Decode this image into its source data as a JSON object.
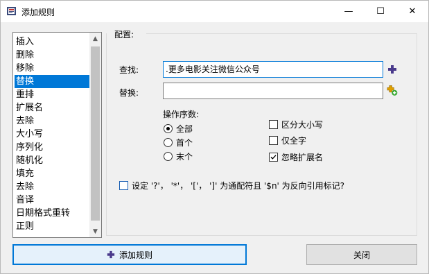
{
  "window": {
    "title": "添加规则",
    "minimize_glyph": "—",
    "maximize_glyph": "☐",
    "close_glyph": "✕"
  },
  "rules_list": {
    "items": [
      "插入",
      "删除",
      "移除",
      "替换",
      "重排",
      "扩展名",
      "去除",
      "大小写",
      "序列化",
      "随机化",
      "填充",
      "去除",
      "音译",
      "日期格式重转",
      "正则"
    ],
    "selected": "替换"
  },
  "config": {
    "group_label": "配置:",
    "find_label": "查找:",
    "find_value": ".更多电影关注微信公众号",
    "replace_label": "替换:",
    "replace_value": "",
    "occurrence_label": "操作序数:",
    "radios": [
      {
        "label": "全部",
        "checked": true
      },
      {
        "label": "首个",
        "checked": false
      },
      {
        "label": "末个",
        "checked": false
      }
    ],
    "checkboxes": [
      {
        "label": "区分大小写",
        "checked": false
      },
      {
        "label": "仅全字",
        "checked": false
      },
      {
        "label": "忽略扩展名",
        "checked": true
      }
    ],
    "wildcard_label": "设定 '?'， '*'， '['， ']' 为通配符且 '$n' 为反向引用标记?",
    "wildcard_checked": false
  },
  "buttons": {
    "add_rule": "添加规则",
    "close": "关闭"
  },
  "colors": {
    "accent": "#0078d7",
    "selection": "#0078d7",
    "plus_icon": "#4a3a8c"
  }
}
